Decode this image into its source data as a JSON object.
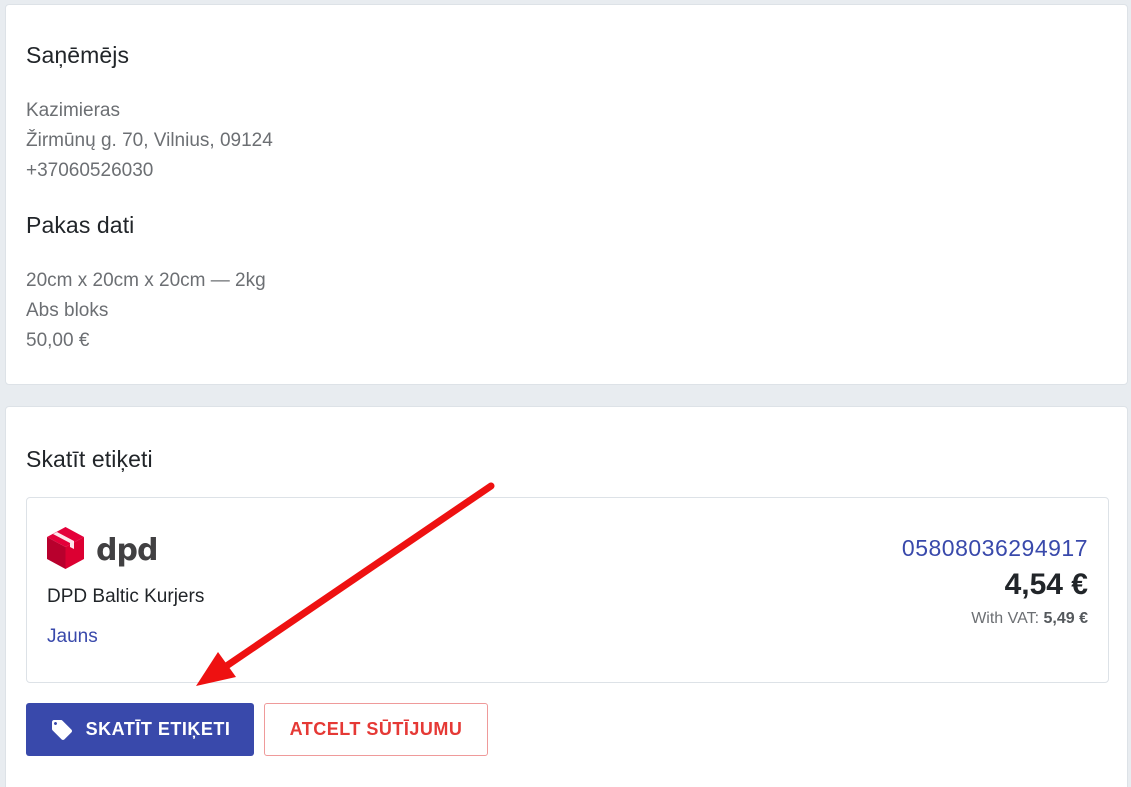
{
  "recipient": {
    "title": "Saņēmējs",
    "name": "Kazimieras",
    "address": "Žirmūnų g. 70, Vilnius, 09124",
    "phone": "+37060526030"
  },
  "package": {
    "title": "Pakas dati",
    "dimensions": "20cm x 20cm x 20cm — 2kg",
    "description": "Abs bloks",
    "value": "50,00 €"
  },
  "label_section": {
    "title": "Skatīt etiķeti",
    "shipment": {
      "carrier_logo_text": "dpd",
      "carrier_name": "DPD Baltic Kurjers",
      "status": "Jauns",
      "tracking_number": "05808036294917",
      "price": "4,54 €",
      "vat_label": "With VAT:",
      "vat_price": "5,49 €"
    },
    "view_label_button": "SKATĪT ETIĶETI",
    "cancel_shipment_button": "ATCELT SŪTĪJUMU"
  },
  "colors": {
    "primary": "#3949ab",
    "danger": "#e53935",
    "dpd_red": "#dc0032",
    "annotation_arrow": "#ee1111"
  },
  "icons": {
    "view_label_button_icon": "tag-icon",
    "carrier_logo_icon": "dpd-cube-icon"
  }
}
